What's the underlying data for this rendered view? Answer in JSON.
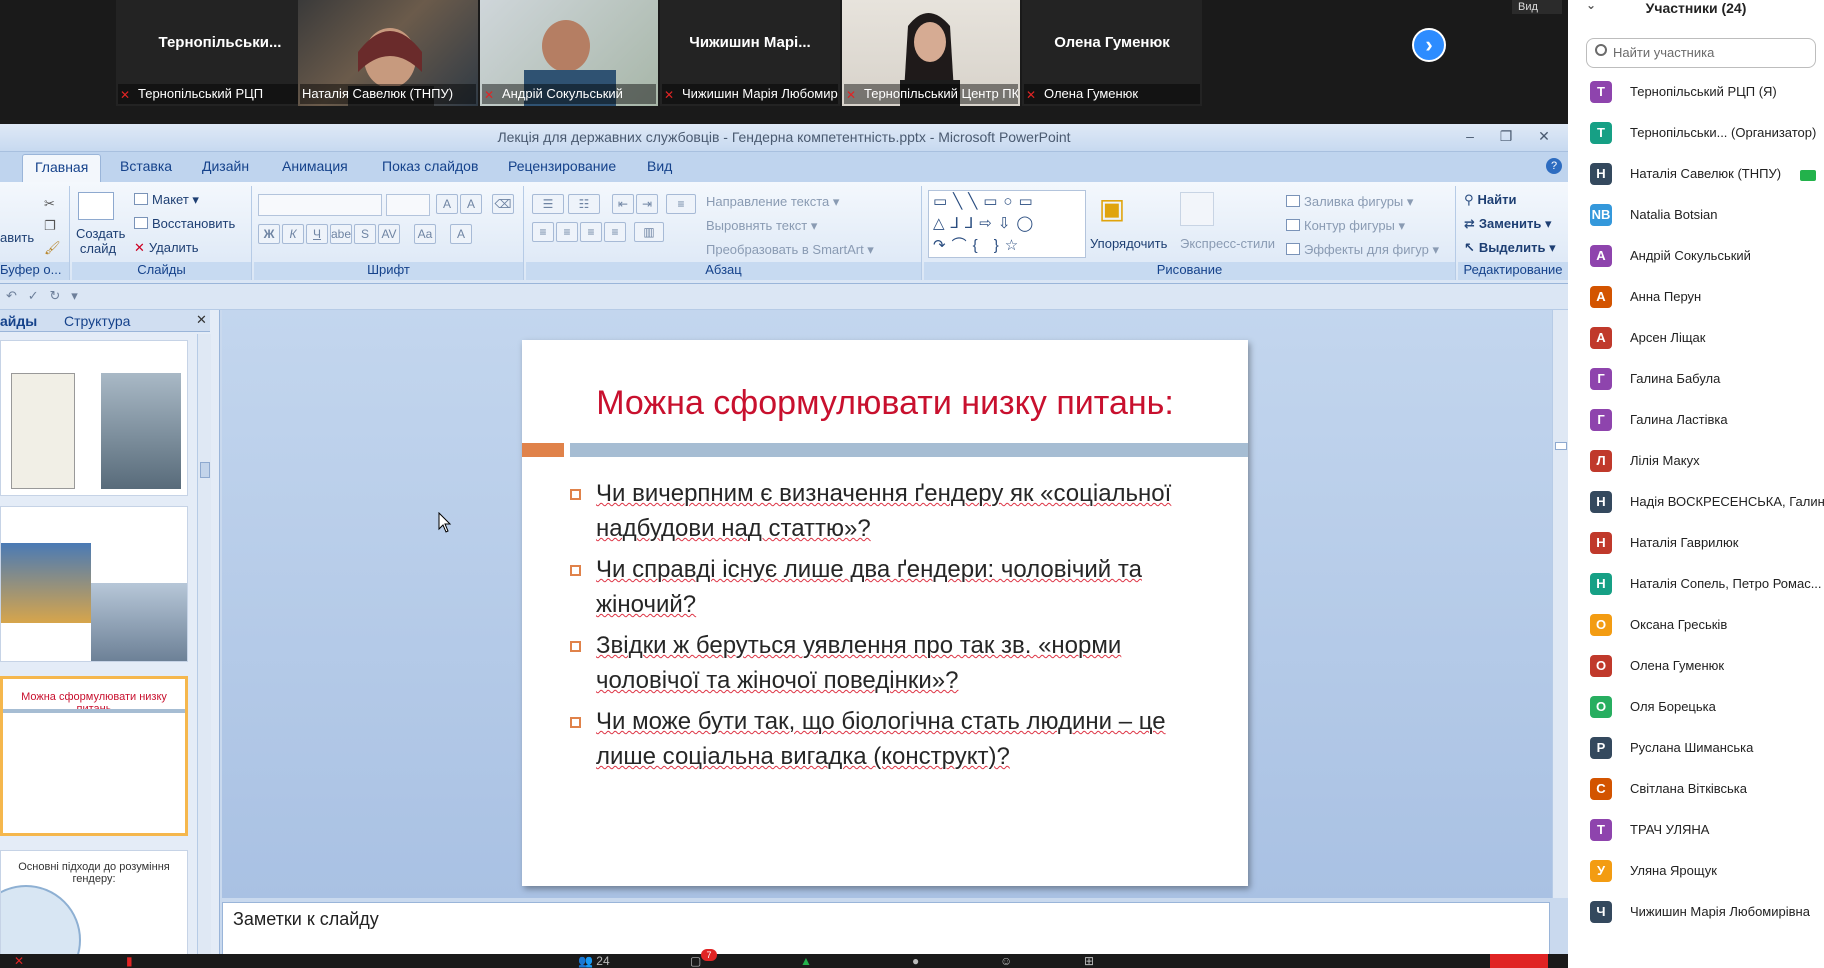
{
  "zoom": {
    "view_label": "Вид",
    "participants_title": "Участники (24)",
    "search_placeholder": "Найти участника",
    "video_tiles": [
      {
        "big_name": "Тернопільськи...",
        "name": "Тернопільський РЦП",
        "muted": true
      },
      {
        "big_name": "",
        "name": "Наталія Савелюк (ТНПУ)",
        "muted": false
      },
      {
        "big_name": "",
        "name": "Андрій Сокульський",
        "muted": true
      },
      {
        "big_name": "Чижишин  Марі...",
        "name": "Чижишин Марія Любомирів...",
        "muted": true
      },
      {
        "big_name": "",
        "name": "Тернопільський Центр ПК",
        "muted": true
      },
      {
        "big_name": "Олена Гуменюк",
        "name": "Олена Гуменюк",
        "muted": true
      }
    ],
    "participants": [
      {
        "initial": "Т",
        "color": "#8e44ad",
        "name": "Тернопільський РЦП (Я)"
      },
      {
        "initial": "Т",
        "color": "#16a085",
        "name": "Тернопільськи...  (Организатор)"
      },
      {
        "initial": "Н",
        "color": "#34495e",
        "name": "Наталія Савелюк (ТНПУ)"
      },
      {
        "initial": "NB",
        "color": "#3498db",
        "name": "Natalia Botsian"
      },
      {
        "initial": "А",
        "color": "#8e44ad",
        "name": "Андрій Сокульський"
      },
      {
        "initial": "А",
        "color": "#d35400",
        "name": "Анна Перун"
      },
      {
        "initial": "А",
        "color": "#c0392b",
        "name": "Арсен Ліщак"
      },
      {
        "initial": "Г",
        "color": "#8e44ad",
        "name": "Галина Бабула"
      },
      {
        "initial": "Г",
        "color": "#8e44ad",
        "name": "Галина Ластівка"
      },
      {
        "initial": "Л",
        "color": "#c0392b",
        "name": "Лілія Макух"
      },
      {
        "initial": "Н",
        "color": "#34495e",
        "name": "Надія ВОСКРЕСЕНСЬКА, Галина Г"
      },
      {
        "initial": "Н",
        "color": "#c0392b",
        "name": "Наталія Гаврилюк"
      },
      {
        "initial": "Н",
        "color": "#16a085",
        "name": "Наталія Сопель, Петро Ромас..."
      },
      {
        "initial": "О",
        "color": "#f39c12",
        "name": "Оксана Греськів"
      },
      {
        "initial": "О",
        "color": "#c0392b",
        "name": "Олена Гуменюк"
      },
      {
        "initial": "О",
        "color": "#27ae60",
        "name": "Оля Борецька"
      },
      {
        "initial": "Р",
        "color": "#34495e",
        "name": "Руслана Шиманська"
      },
      {
        "initial": "С",
        "color": "#d35400",
        "name": "Світлана Вітківська"
      },
      {
        "initial": "Т",
        "color": "#8e44ad",
        "name": "ТРАЧ УЛЯНА"
      },
      {
        "initial": "У",
        "color": "#f39c12",
        "name": "Уляна Ярощук"
      },
      {
        "initial": "Ч",
        "color": "#34495e",
        "name": "Чижишин Марія Любомирівна"
      }
    ],
    "bottom": {
      "participants_count": "24",
      "chat_badge": "7"
    }
  },
  "ppt": {
    "window_title": "Лекція для державних службовців - Гендерна компетентність.pptx - Microsoft PowerPoint",
    "tabs": [
      "Главная",
      "Вставка",
      "Дизайн",
      "Анимация",
      "Показ слайдов",
      "Рецензирование",
      "Вид"
    ],
    "groups": {
      "clipboard_label": "Буфер о...",
      "clipboard_paste": "авить",
      "slides_label": "Слайды",
      "slides_new": "Создать слайд",
      "slides_layout": "Макет",
      "slides_reset": "Восстановить",
      "slides_delete": "Удалить",
      "font_label": "Шрифт",
      "paragraph_label": "Абзац",
      "para_direction": "Направление текста",
      "para_align": "Выровнять текст",
      "para_smartart": "Преобразовать в SmartArt",
      "drawing_label": "Рисование",
      "draw_arrange": "Упорядочить",
      "draw_styles": "Экспресс-стили",
      "draw_fill": "Заливка фигуры",
      "draw_outline": "Контур фигуры",
      "draw_effects": "Эффекты для фигур",
      "editing_label": "Редактирование",
      "edit_find": "Найти",
      "edit_replace": "Заменить",
      "edit_select": "Выделить"
    },
    "left_tabs": [
      "айды",
      "Структура"
    ],
    "thumb_titles": [
      "Можна сформулювати низку питань",
      "Основні підходи до розуміння гендеру:"
    ],
    "slide": {
      "title": "Можна сформулювати  низку питань:",
      "bullets": [
        "Чи вичерпним є визначення ґендеру як «соціальної надбудови над статтю»?",
        "Чи справді існує лише два ґендери: чоловічий та жіночий?",
        "Звідки ж беруться уявлення про так зв. «норми чоловічої та жіночої поведінки»?",
        "Чи може бути так, що біологічна стать людини – це лише соціальна вигадка (конструкт)?"
      ],
      "colors": {
        "title": "#c8102e",
        "accent": "#e0824a",
        "band": "#a6bdd3"
      }
    },
    "notes_label": "Заметки к слайду"
  }
}
